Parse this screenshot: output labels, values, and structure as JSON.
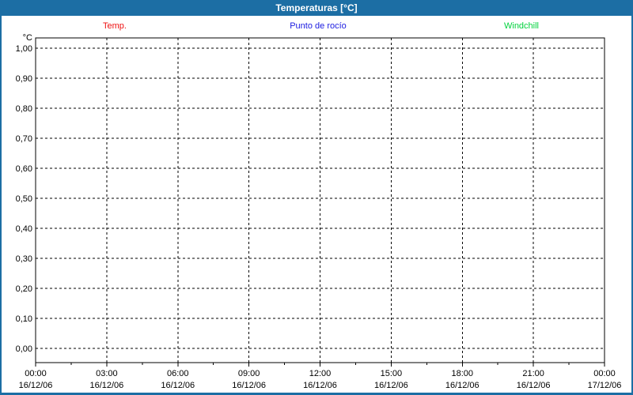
{
  "window": {
    "title": "Temperaturas [°C]"
  },
  "colors": {
    "frame_blue": "#1c6ea4",
    "title_text": "#ffffff",
    "axis_text": "#000000",
    "grid": "#000000",
    "plot_background": "#ffffff"
  },
  "chart_data": {
    "type": "line",
    "title": "Temperaturas [°C]",
    "grid": {
      "style": "dashed",
      "color": "#000000"
    },
    "no_data_plotted": true,
    "y_axis": {
      "unit_label": "°C",
      "range": [
        0.0,
        1.0
      ],
      "tick_step": 0.1,
      "tick_labels": [
        "1,00",
        "0,90",
        "0,80",
        "0,70",
        "0,60",
        "0,50",
        "0,40",
        "0,30",
        "0,20",
        "0,10",
        "0,00"
      ],
      "tick_values": [
        1.0,
        0.9,
        0.8,
        0.7,
        0.6,
        0.5,
        0.4,
        0.3,
        0.2,
        0.1,
        0.0
      ]
    },
    "x_axis": {
      "range_hours": [
        0,
        24
      ],
      "major_interval_hours": 3,
      "minor_interval_hours": 1.5,
      "tick_labels": [
        {
          "time": "00:00",
          "date": "16/12/06"
        },
        {
          "time": "03:00",
          "date": "16/12/06"
        },
        {
          "time": "06:00",
          "date": "16/12/06"
        },
        {
          "time": "09:00",
          "date": "16/12/06"
        },
        {
          "time": "12:00",
          "date": "16/12/06"
        },
        {
          "time": "15:00",
          "date": "16/12/06"
        },
        {
          "time": "18:00",
          "date": "16/12/06"
        },
        {
          "time": "21:00",
          "date": "16/12/06"
        },
        {
          "time": "00:00",
          "date": "17/12/06"
        }
      ]
    },
    "series": [
      {
        "name": "Temp.",
        "color": "#ee1111",
        "points": []
      },
      {
        "name": "Punto de rocío",
        "color": "#1a1ae0",
        "points": []
      },
      {
        "name": "Windchill",
        "color": "#00d23c",
        "points": []
      }
    ]
  }
}
